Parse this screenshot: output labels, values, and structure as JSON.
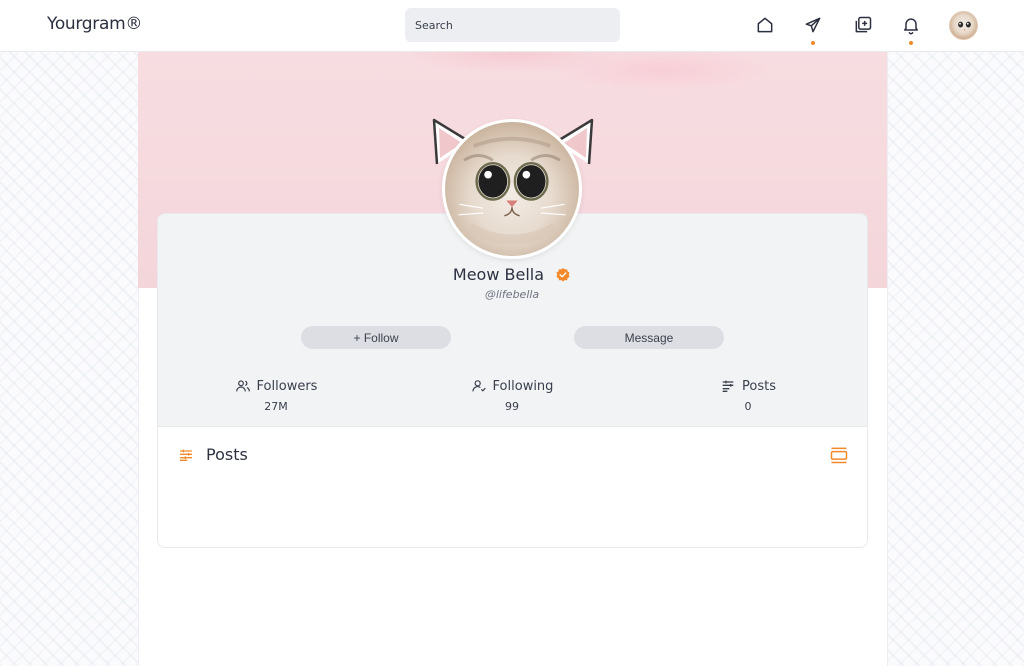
{
  "nav": {
    "brand": "Yourgram®",
    "search_placeholder": "Search",
    "icons": [
      "home-icon",
      "send-icon",
      "add-post-icon",
      "bell-icon"
    ],
    "accent_color": "#f28a2b"
  },
  "cover": {
    "color": "#f5d9de"
  },
  "profile": {
    "name": "Meow Bella",
    "handle": "@lifebella",
    "verified_color": "#f28a2b"
  },
  "actions": {
    "follow_label": "+ Follow",
    "message_label": "Message"
  },
  "stats": {
    "followers": {
      "label": "Followers",
      "value": "27M"
    },
    "following": {
      "label": "Following",
      "value": "99"
    },
    "posts": {
      "label": "Posts",
      "value": "0"
    }
  },
  "posts_section": {
    "title": "Posts"
  }
}
